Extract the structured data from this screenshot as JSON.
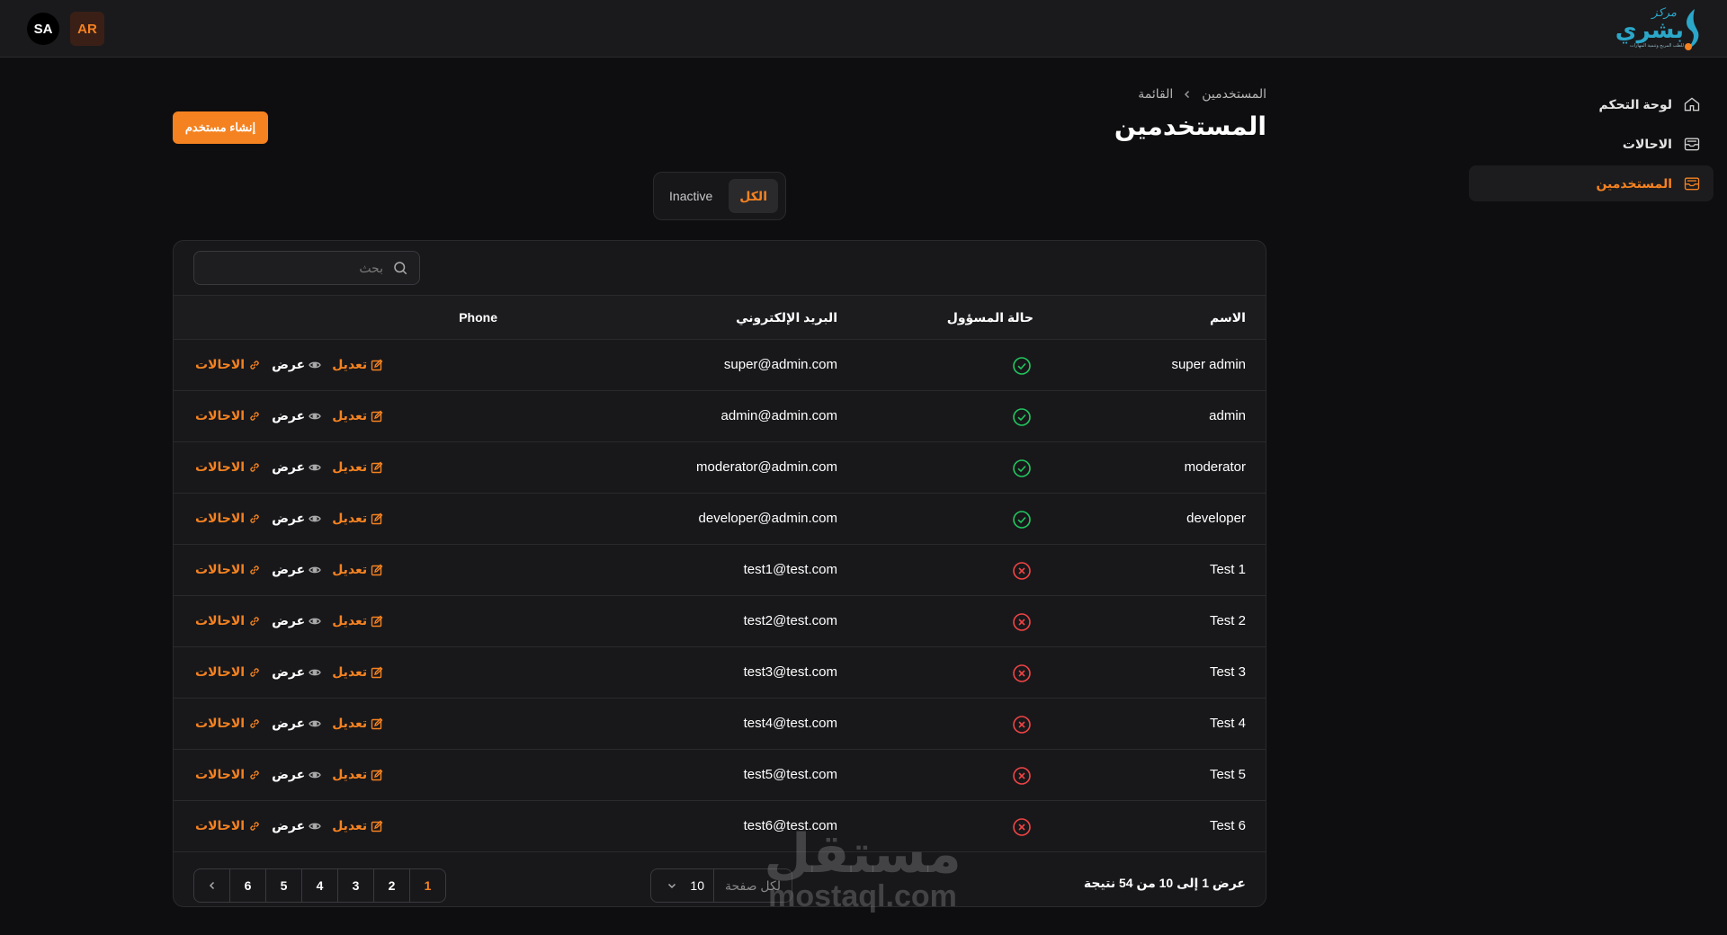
{
  "header": {
    "logo": {
      "small": "مركز",
      "big": "بشري",
      "tagline": "للطب المريح وتنمية المهارات"
    },
    "lang_sa": "SA",
    "lang_ar": "AR"
  },
  "sidebar": {
    "items": [
      {
        "label": "لوحة التحكم",
        "icon": "home-icon",
        "active": false
      },
      {
        "label": "الاحالات",
        "icon": "inbox-icon",
        "active": false
      },
      {
        "label": "المستخدمين",
        "icon": "inbox-icon",
        "active": true
      }
    ]
  },
  "breadcrumb": {
    "items": [
      "المستخدمين",
      "القائمة"
    ]
  },
  "page": {
    "title": "المستخدمين",
    "create_button": "إنشاء مستخدم"
  },
  "tabs": [
    {
      "label": "الكل",
      "active": true
    },
    {
      "label": "Inactive",
      "active": false
    }
  ],
  "search": {
    "placeholder": "بحث",
    "value": ""
  },
  "table": {
    "columns": {
      "name": "الاسم",
      "status": "حالة المسؤول",
      "email": "البريد الإلكتروني",
      "phone": "Phone"
    },
    "actions": {
      "edit": "تعديل",
      "view": "عرض",
      "referrals": "الاحالات"
    },
    "rows": [
      {
        "name": "super admin",
        "admin": true,
        "email": "super@admin.com"
      },
      {
        "name": "admin",
        "admin": true,
        "email": "admin@admin.com"
      },
      {
        "name": "moderator",
        "admin": true,
        "email": "moderator@admin.com"
      },
      {
        "name": "developer",
        "admin": true,
        "email": "developer@admin.com"
      },
      {
        "name": "Test 1",
        "admin": false,
        "email": "test1@test.com"
      },
      {
        "name": "Test 2",
        "admin": false,
        "email": "test2@test.com"
      },
      {
        "name": "Test 3",
        "admin": false,
        "email": "test3@test.com"
      },
      {
        "name": "Test 4",
        "admin": false,
        "email": "test4@test.com"
      },
      {
        "name": "Test 5",
        "admin": false,
        "email": "test5@test.com"
      },
      {
        "name": "Test 6",
        "admin": false,
        "email": "test6@test.com"
      }
    ]
  },
  "footer": {
    "results": "عرض 1 إلى 10 من 54 نتيجة",
    "per_page_label": "لكل صفحة",
    "per_page_value": "10",
    "pages": [
      "1",
      "2",
      "3",
      "4",
      "5",
      "6"
    ],
    "current_page": "1"
  },
  "watermark": {
    "line1": "مستقل",
    "line2": "mostaql.com"
  },
  "colors": {
    "accent": "#f58220",
    "success": "#22c55e",
    "danger": "#ef4444",
    "background": "#0e0e10",
    "card": "#18181b"
  }
}
